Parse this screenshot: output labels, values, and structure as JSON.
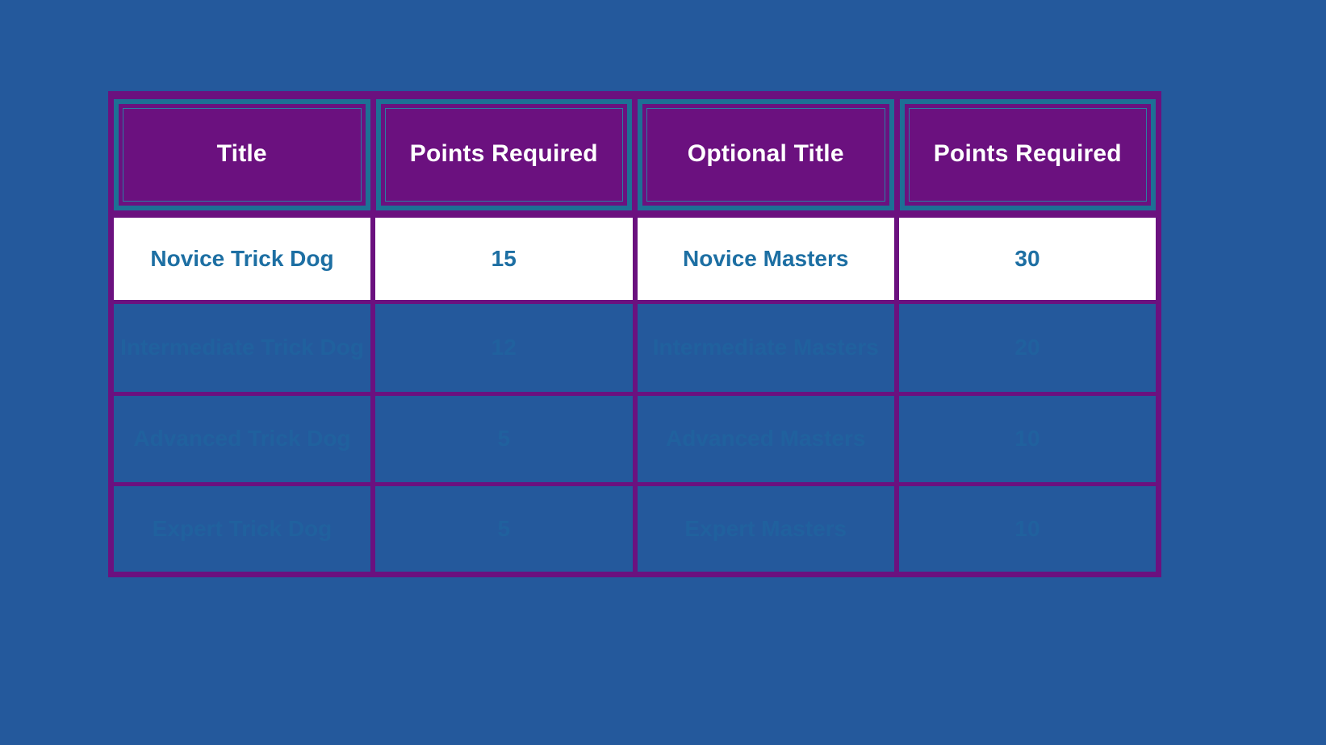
{
  "page": {
    "background_color": "#24599c",
    "table_border_color": "#6b117f",
    "header_border_color": "#1d7095",
    "header_text_color": "#ffffff",
    "body_text_color": "#1d6fa3",
    "faded_row_text_color": "#1c6ca2",
    "white_row_background": "#ffffff"
  },
  "table": {
    "columns": [
      {
        "label": "Title"
      },
      {
        "label": "Points Required"
      },
      {
        "label": "Optional Title"
      },
      {
        "label": "Points Required"
      }
    ],
    "rows": [
      {
        "style": "white",
        "cells": [
          "Novice Trick Dog",
          "15",
          "Novice Masters",
          "30"
        ]
      },
      {
        "style": "faded",
        "cells": [
          "Intermediate Trick Dog",
          "12",
          "Intermediate Masters",
          "20"
        ]
      },
      {
        "style": "faded",
        "cells": [
          "Advanced Trick Dog",
          "5",
          "Advanced Masters",
          "10"
        ]
      },
      {
        "style": "faded",
        "cells": [
          "Expert Trick Dog",
          "5",
          "Expert Masters",
          "10"
        ]
      }
    ]
  }
}
